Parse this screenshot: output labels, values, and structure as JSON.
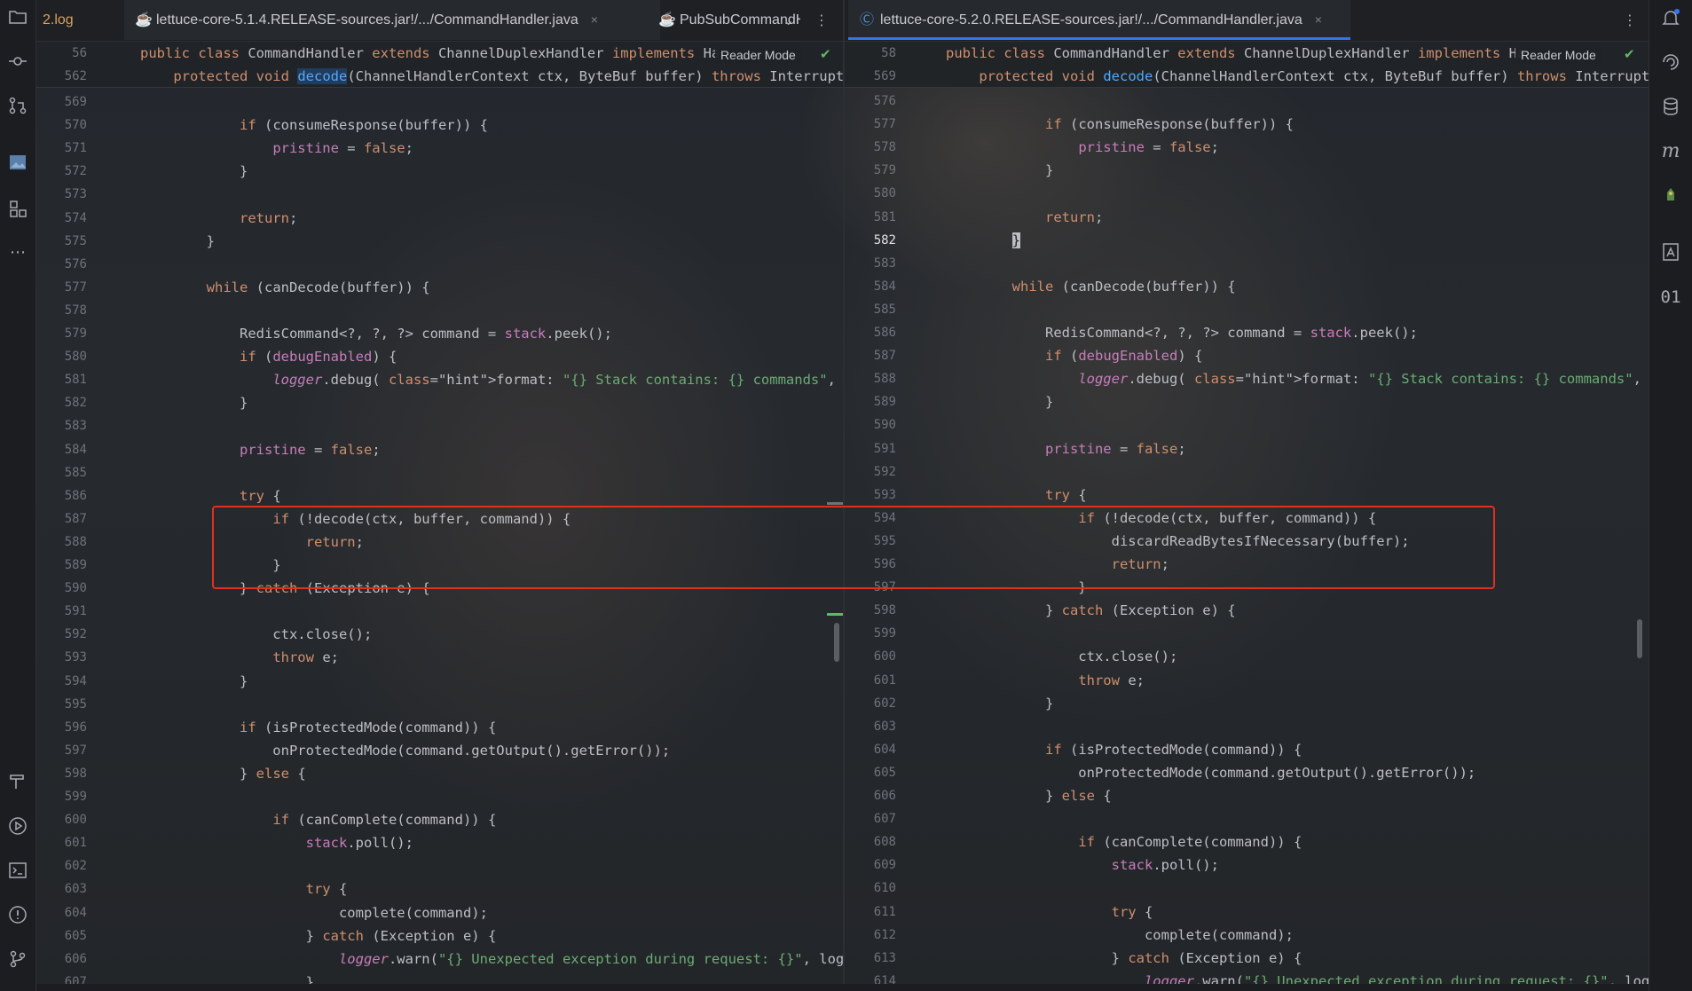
{
  "tabs": {
    "log_tab": "2.log",
    "left_active_tab": "lettuce-core-5.1.4.RELEASE-sources.jar!/.../CommandHandler.java",
    "pubsub_tab": "PubSubCommandH",
    "right_active_tab": "lettuce-core-5.2.0.RELEASE-sources.jar!/.../CommandHandler.java",
    "close_glyph": "×",
    "overflow_glyph": "⌄",
    "more_glyph": "⋮"
  },
  "reader_mode_label": "Reader Mode",
  "left_pane": {
    "sticky": [
      {
        "ln": "56",
        "code": "public class CommandHandler extends ChannelDuplexHandler implements Ha"
      },
      {
        "ln": "562",
        "code": "    protected void decode(ChannelHandlerContext ctx, ByteBuf buffer) throws InterruptedE"
      }
    ],
    "lines": [
      {
        "ln": "569",
        "code": ""
      },
      {
        "ln": "570",
        "code": "            if (consumeResponse(buffer)) {"
      },
      {
        "ln": "571",
        "code": "                pristine = false;"
      },
      {
        "ln": "572",
        "code": "            }"
      },
      {
        "ln": "573",
        "code": ""
      },
      {
        "ln": "574",
        "code": "            return;"
      },
      {
        "ln": "575",
        "code": "        }"
      },
      {
        "ln": "576",
        "code": ""
      },
      {
        "ln": "577",
        "code": "        while (canDecode(buffer)) {"
      },
      {
        "ln": "578",
        "code": ""
      },
      {
        "ln": "579",
        "code": "            RedisCommand<?, ?, ?> command = stack.peek();"
      },
      {
        "ln": "580",
        "code": "            if (debugEnabled) {"
      },
      {
        "ln": "581",
        "code": "                logger.debug( format: \"{} Stack contains: {} commands\", logPrefix(), stack"
      },
      {
        "ln": "582",
        "code": "            }"
      },
      {
        "ln": "583",
        "code": ""
      },
      {
        "ln": "584",
        "code": "            pristine = false;"
      },
      {
        "ln": "585",
        "code": ""
      },
      {
        "ln": "586",
        "code": "            try {"
      },
      {
        "ln": "587",
        "code": "                if (!decode(ctx, buffer, command)) {"
      },
      {
        "ln": "588",
        "code": "                    return;"
      },
      {
        "ln": "589",
        "code": "                }"
      },
      {
        "ln": "590",
        "code": "            } catch (Exception e) {"
      },
      {
        "ln": "591",
        "code": ""
      },
      {
        "ln": "592",
        "code": "                ctx.close();"
      },
      {
        "ln": "593",
        "code": "                throw e;"
      },
      {
        "ln": "594",
        "code": "            }"
      },
      {
        "ln": "595",
        "code": ""
      },
      {
        "ln": "596",
        "code": "            if (isProtectedMode(command)) {"
      },
      {
        "ln": "597",
        "code": "                onProtectedMode(command.getOutput().getError());"
      },
      {
        "ln": "598",
        "code": "            } else {"
      },
      {
        "ln": "599",
        "code": ""
      },
      {
        "ln": "600",
        "code": "                if (canComplete(command)) {"
      },
      {
        "ln": "601",
        "code": "                    stack.poll();"
      },
      {
        "ln": "602",
        "code": ""
      },
      {
        "ln": "603",
        "code": "                    try {"
      },
      {
        "ln": "604",
        "code": "                        complete(command);"
      },
      {
        "ln": "605",
        "code": "                    } catch (Exception e) {"
      },
      {
        "ln": "606",
        "code": "                        logger.warn(\"{} Unexpected exception during request: {}\", logPre"
      },
      {
        "ln": "607",
        "code": "                    }"
      }
    ]
  },
  "right_pane": {
    "sticky": [
      {
        "ln": "58",
        "code": "public class CommandHandler extends ChannelDuplexHandler implements Ha"
      },
      {
        "ln": "569",
        "code": "    protected void decode(ChannelHandlerContext ctx, ByteBuf buffer) throws InterruptedE"
      }
    ],
    "current_line": "582",
    "lines": [
      {
        "ln": "576",
        "code": ""
      },
      {
        "ln": "577",
        "code": "            if (consumeResponse(buffer)) {"
      },
      {
        "ln": "578",
        "code": "                pristine = false;"
      },
      {
        "ln": "579",
        "code": "            }"
      },
      {
        "ln": "580",
        "code": ""
      },
      {
        "ln": "581",
        "code": "            return;"
      },
      {
        "ln": "582",
        "code": "        }"
      },
      {
        "ln": "583",
        "code": ""
      },
      {
        "ln": "584",
        "code": "        while (canDecode(buffer)) {"
      },
      {
        "ln": "585",
        "code": ""
      },
      {
        "ln": "586",
        "code": "            RedisCommand<?, ?, ?> command = stack.peek();"
      },
      {
        "ln": "587",
        "code": "            if (debugEnabled) {"
      },
      {
        "ln": "588",
        "code": "                logger.debug( format: \"{} Stack contains: {} commands\", logPrefix(), stack"
      },
      {
        "ln": "589",
        "code": "            }"
      },
      {
        "ln": "590",
        "code": ""
      },
      {
        "ln": "591",
        "code": "            pristine = false;"
      },
      {
        "ln": "592",
        "code": ""
      },
      {
        "ln": "593",
        "code": "            try {"
      },
      {
        "ln": "594",
        "code": "                if (!decode(ctx, buffer, command)) {"
      },
      {
        "ln": "595",
        "code": "                    discardReadBytesIfNecessary(buffer);"
      },
      {
        "ln": "596",
        "code": "                    return;"
      },
      {
        "ln": "597",
        "code": "                }"
      },
      {
        "ln": "598",
        "code": "            } catch (Exception e) {"
      },
      {
        "ln": "599",
        "code": ""
      },
      {
        "ln": "600",
        "code": "                ctx.close();"
      },
      {
        "ln": "601",
        "code": "                throw e;"
      },
      {
        "ln": "602",
        "code": "            }"
      },
      {
        "ln": "603",
        "code": ""
      },
      {
        "ln": "604",
        "code": "            if (isProtectedMode(command)) {"
      },
      {
        "ln": "605",
        "code": "                onProtectedMode(command.getOutput().getError());"
      },
      {
        "ln": "606",
        "code": "            } else {"
      },
      {
        "ln": "607",
        "code": ""
      },
      {
        "ln": "608",
        "code": "                if (canComplete(command)) {"
      },
      {
        "ln": "609",
        "code": "                    stack.poll();"
      },
      {
        "ln": "610",
        "code": ""
      },
      {
        "ln": "611",
        "code": "                    try {"
      },
      {
        "ln": "612",
        "code": "                        complete(command);"
      },
      {
        "ln": "613",
        "code": "                    } catch (Exception e) {"
      },
      {
        "ln": "614",
        "code": "                        logger.warn(\"{} Unexpected exception during request: {}\", logPre"
      }
    ]
  },
  "left_toolbar": {
    "project": "folder-icon",
    "commit": "commit-icon",
    "pull_requests": "pull-request-icon",
    "image": "image-icon",
    "structure": "structure-icon",
    "more": "more-icon",
    "build": "hammer-icon",
    "run": "run-icon",
    "terminal": "terminal-icon",
    "problems": "problems-icon",
    "git": "git-icon"
  },
  "right_toolbar": {
    "notifications": "bell-icon",
    "ai": "ai-assistant-icon",
    "database": "database-icon",
    "maven": "maven-icon",
    "plugin": "plugin-icon",
    "translate": "translate-icon",
    "binary": "binary-icon"
  },
  "colors": {
    "accent": "#3574f0",
    "highlight_box": "#e0301e",
    "keyword": "#cf8e6d",
    "field": "#c77dbb",
    "string": "#6aab73"
  }
}
